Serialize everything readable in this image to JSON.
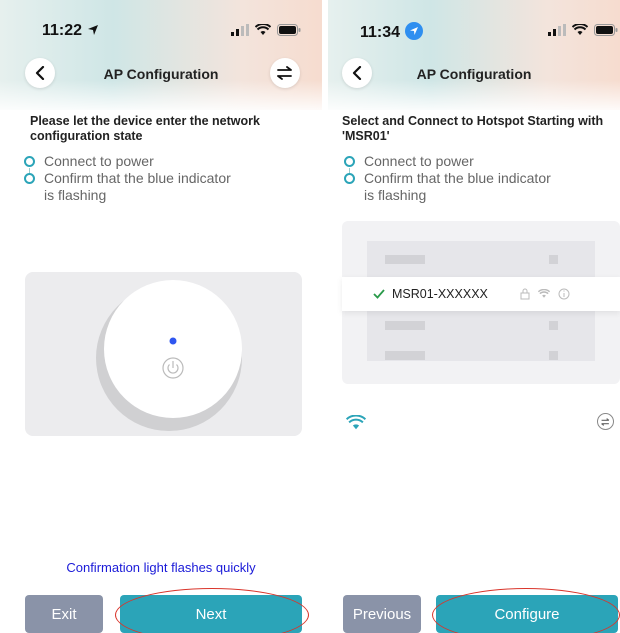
{
  "left": {
    "status": {
      "time": "11:22"
    },
    "header": {
      "title": "AP Configuration"
    },
    "instruction": "Please let the device enter the network configuration state",
    "steps": [
      "Connect to power",
      "Confirm that the blue indicator is flashing"
    ],
    "confirmation": "Confirmation light flashes quickly",
    "buttons": {
      "exit": "Exit",
      "next": "Next"
    }
  },
  "right": {
    "status": {
      "time": "11:34"
    },
    "header": {
      "title": "AP Configuration"
    },
    "instruction": "Select and Connect to Hotspot Starting with 'MSR01'",
    "steps": [
      "Connect to power",
      "Confirm that the blue indicator is flashing"
    ],
    "wifi_list": {
      "selected_network": "MSR01-XXXXXX"
    },
    "buttons": {
      "previous": "Previous",
      "configure": "Configure"
    }
  },
  "colors": {
    "accent": "#2ba4b8",
    "exit_btn": "#8a93a8",
    "indicator": "#2f56f0",
    "annotation": "#d9352b",
    "link_text": "#1a1ad8"
  },
  "icons": [
    "location-arrow-icon",
    "signal-icon",
    "wifi-icon",
    "battery-icon",
    "back-icon",
    "swap-icon",
    "power-icon",
    "check-icon",
    "lock-icon",
    "info-icon"
  ]
}
